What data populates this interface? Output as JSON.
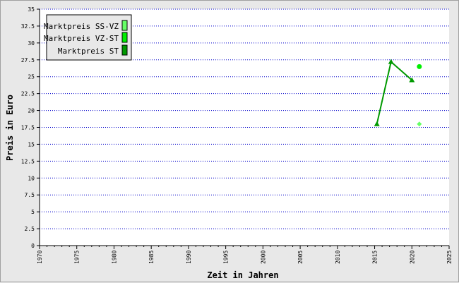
{
  "chart_data": {
    "type": "line",
    "xlabel": "Zeit in Jahren",
    "ylabel": "Preis in Euro",
    "xlim": [
      1970,
      2025
    ],
    "ylim": [
      0,
      35
    ],
    "x_ticks": [
      "1970",
      "1975",
      "1980",
      "1985",
      "1990",
      "1995",
      "2000",
      "2005",
      "2010",
      "2015",
      "2020",
      "2025"
    ],
    "y_ticks": [
      "0",
      "2.5",
      "5",
      "7.5",
      "10",
      "12.5",
      "15",
      "17.5",
      "20",
      "22.5",
      "25",
      "27.5",
      "30",
      "32.5",
      "35"
    ],
    "grid": true,
    "legend_position": "top-left",
    "legend": [
      "Marktpreis SS-VZ",
      "Marktpreis VZ-ST",
      "Marktpreis ST"
    ],
    "series": [
      {
        "name": "Marktpreis SS-VZ",
        "color": "#66ff66",
        "marker": "diamond",
        "points": [
          [
            2021,
            18
          ]
        ]
      },
      {
        "name": "Marktpreis VZ-ST",
        "color": "#00ee00",
        "marker": "circle",
        "points": [
          [
            2021,
            26.5
          ]
        ]
      },
      {
        "name": "Marktpreis ST",
        "color": "#009900",
        "marker": "triangle",
        "line": true,
        "points": [
          [
            2015.3,
            18
          ],
          [
            2017.2,
            27.2
          ],
          [
            2020,
            24.5
          ]
        ]
      }
    ],
    "colors": {
      "background": "#e8e8e8",
      "plot": "#ffffff",
      "grid": "#0000cc"
    }
  }
}
